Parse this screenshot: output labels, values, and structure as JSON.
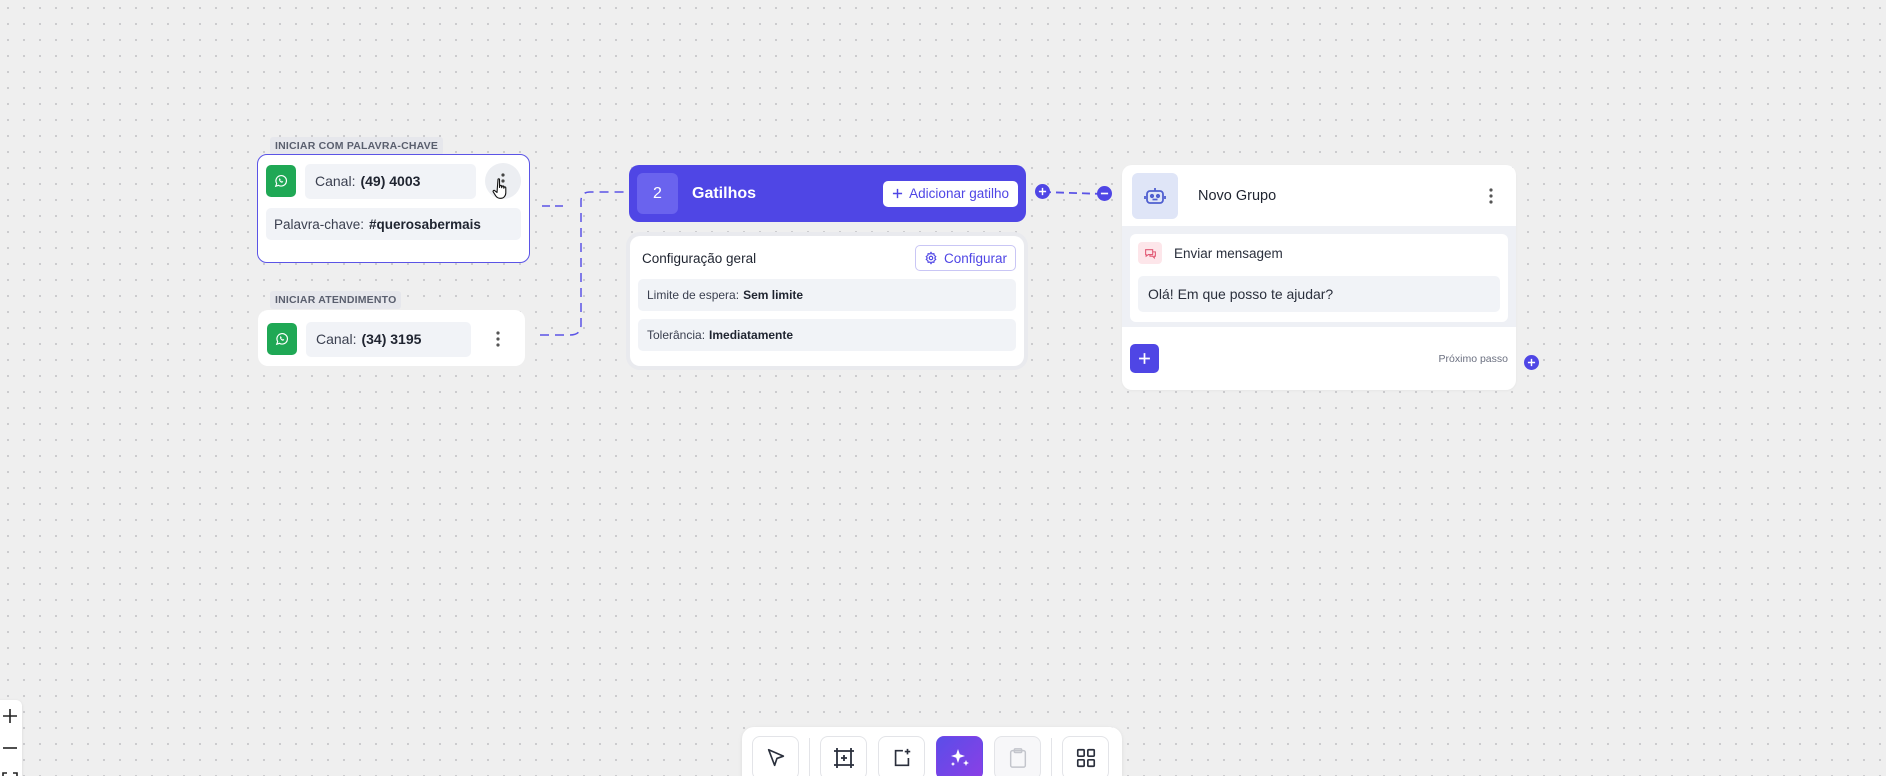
{
  "triggers": [
    {
      "tag": "INICIAR COM PALAVRA-CHAVE",
      "channel_label": "Canal:",
      "channel_value": "(49) 4003",
      "keyword_label": "Palavra-chave:",
      "keyword_value": "#querosabermais"
    },
    {
      "tag": "INICIAR ATENDIMENTO",
      "channel_label": "Canal:",
      "channel_value": "(34) 3195"
    }
  ],
  "gatilhos": {
    "count": "2",
    "title": "Gatilhos",
    "add_label": "Adicionar gatilho",
    "config": {
      "title": "Configuração geral",
      "button_label": "Configurar",
      "rows": [
        {
          "label": "Limite de espera:",
          "value": "Sem limite"
        },
        {
          "label": "Tolerância:",
          "value": "Imediatamente"
        }
      ]
    }
  },
  "group": {
    "title": "Novo Grupo",
    "message_title": "Enviar mensagem",
    "message_text": "Olá! Em que posso te ajudar?",
    "next_step_label": "Próximo passo"
  },
  "colors": {
    "accent": "#4f46e5",
    "whatsapp": "#1fa855",
    "canvas": "#efefef"
  },
  "icons": [
    "whatsapp-icon",
    "kebab-icon",
    "hand-cursor-icon",
    "plus-icon",
    "gear-icon",
    "robot-icon",
    "message-icon",
    "minus-icon",
    "select-cursor-icon",
    "frame-add-icon",
    "note-add-icon",
    "sparkles-icon",
    "clipboard-icon",
    "grid-icon"
  ]
}
